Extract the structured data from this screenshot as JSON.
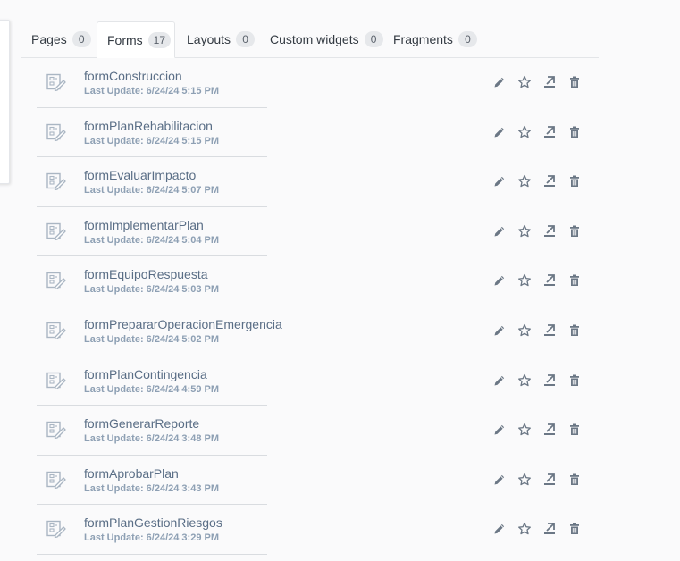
{
  "tabs": [
    {
      "label": "Pages",
      "count": "0"
    },
    {
      "label": "Forms",
      "count": "17"
    },
    {
      "label": "Layouts",
      "count": "0"
    },
    {
      "label": "Custom widgets",
      "count": "0"
    },
    {
      "label": "Fragments",
      "count": "0"
    }
  ],
  "active_tab": "Forms",
  "forms": [
    {
      "name": "formConstruccion",
      "updated": "Last Update: 6/24/24 5:15 PM"
    },
    {
      "name": "formPlanRehabilitacion",
      "updated": "Last Update: 6/24/24 5:15 PM"
    },
    {
      "name": "formEvaluarImpacto",
      "updated": "Last Update: 6/24/24 5:07 PM"
    },
    {
      "name": "formImplementarPlan",
      "updated": "Last Update: 6/24/24 5:04 PM"
    },
    {
      "name": "formEquipoRespuesta",
      "updated": "Last Update: 6/24/24 5:03 PM"
    },
    {
      "name": "formPrepararOperacionEmergencia",
      "updated": "Last Update: 6/24/24 5:02 PM"
    },
    {
      "name": "formPlanContingencia",
      "updated": "Last Update: 6/24/24 4:59 PM"
    },
    {
      "name": "formGenerarReporte",
      "updated": "Last Update: 6/24/24 3:48 PM"
    },
    {
      "name": "formAprobarPlan",
      "updated": "Last Update: 6/24/24 3:43 PM"
    },
    {
      "name": "formPlanGestionRiesgos",
      "updated": "Last Update: 6/24/24 3:29 PM"
    }
  ],
  "icons": {
    "form": "form-icon",
    "edit": "pencil-icon",
    "favorite": "star-icon",
    "export": "export-icon",
    "delete": "trash-icon"
  },
  "colors": {
    "background": "#fafafb",
    "link": "#5a6e86",
    "meta": "#8ea0b4",
    "icon": "#6b7785"
  }
}
